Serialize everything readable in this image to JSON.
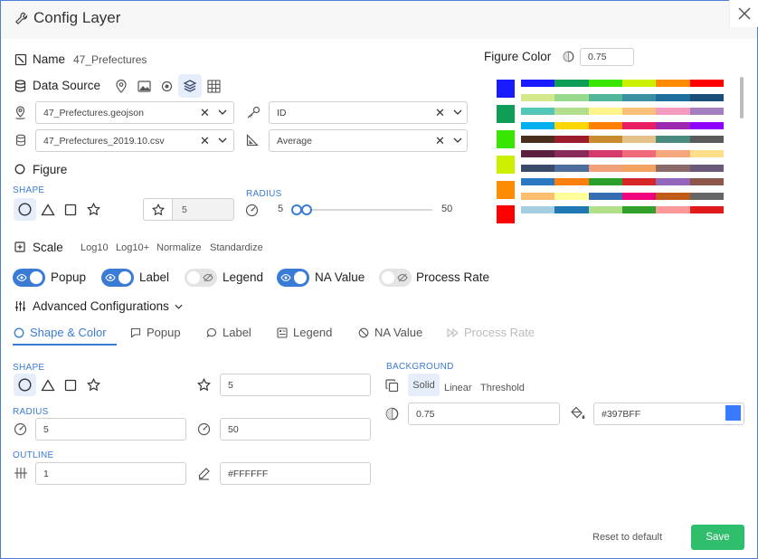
{
  "window": {
    "title": "Config Layer"
  },
  "name": {
    "label": "Name",
    "value": "47_Prefectures"
  },
  "data_source": {
    "label": "Data Source",
    "geo_file": "47_Prefectures.geojson",
    "key_field": "ID",
    "csv_file": "47_Prefectures_2019.10.csv",
    "value_field": "Average"
  },
  "figure": {
    "label": "Figure",
    "shape_label": "SHAPE",
    "size_value": "5",
    "radius_label": "RADIUS",
    "radius_min": "5",
    "radius_max": "50"
  },
  "scale": {
    "label": "Scale",
    "options": [
      "Log10",
      "Log10+",
      "Normalize",
      "Standardize"
    ]
  },
  "toggles": [
    {
      "label": "Popup",
      "on": true
    },
    {
      "label": "Label",
      "on": true
    },
    {
      "label": "Legend",
      "on": false
    },
    {
      "label": "NA Value",
      "on": true
    },
    {
      "label": "Process Rate",
      "on": false
    }
  ],
  "advanced": {
    "label": "Advanced Configurations",
    "tabs": [
      "Shape & Color",
      "Popup",
      "Label",
      "Legend",
      "NA Value",
      "Process Rate"
    ]
  },
  "shape_color": {
    "shape_label": "SHAPE",
    "size_value": "5",
    "radius_label": "RADIUS",
    "radius_min": "5",
    "radius_max": "50",
    "outline_label": "OUTLINE",
    "outline_width": "1",
    "outline_color": "#FFFFFF",
    "background_label": "BACKGROUND",
    "background_options": [
      "Solid",
      "Linear",
      "Threshold"
    ],
    "opacity": "0.75",
    "fill_color": "#397BFF"
  },
  "figure_color": {
    "label": "Figure Color",
    "opacity": "0.75",
    "swatches": [
      "#1a1aff",
      "#0f9d58",
      "#39e600",
      "#ccf000",
      "#ff8c00",
      "#ff0000"
    ],
    "palettes": [
      [
        "#1a1aff",
        "#0f9d58",
        "#39e600",
        "#ccf000",
        "#ff8c00",
        "#ff0000"
      ],
      [
        "#d4e98e",
        "#98d98e",
        "#52b79a",
        "#3a8fa0",
        "#1f6f9e",
        "#1b4f7a"
      ],
      [
        "#52c7b8",
        "#b3de8e",
        "#fff38e",
        "#fdc078",
        "#f49cbf",
        "#a47fbf"
      ],
      [
        "#00b0f0",
        "#ffd700",
        "#ff7f00",
        "#e91e63",
        "#9c27b0",
        "#8e00ff"
      ],
      [
        "#4a2f1f",
        "#9b1c2c",
        "#c98b2d",
        "#e3c188",
        "#4b8a7e",
        "#5a5a5a"
      ],
      [
        "#5b1f3f",
        "#8a2a5a",
        "#d63a6a",
        "#f06a7a",
        "#f5a67a",
        "#ffe08a"
      ],
      [
        "#3a4a6b",
        "#4e6f9e",
        "#f2a07a",
        "#f4a261",
        "#8a6a6a",
        "#6a5a7a"
      ],
      [
        "#2b78c2",
        "#ff7f0e",
        "#2ca02c",
        "#d62728",
        "#9467bd",
        "#8c564b"
      ],
      [
        "#fdbf6f",
        "#ffff99",
        "#386cb0",
        "#f0027f",
        "#bf5b17",
        "#666666"
      ],
      [
        "#a6cee3",
        "#1f78b4",
        "#b2df8a",
        "#33a02c",
        "#fb9a99",
        "#e31a1c"
      ]
    ]
  },
  "footer": {
    "reset_label": "Reset to default",
    "save_label": "Save"
  }
}
